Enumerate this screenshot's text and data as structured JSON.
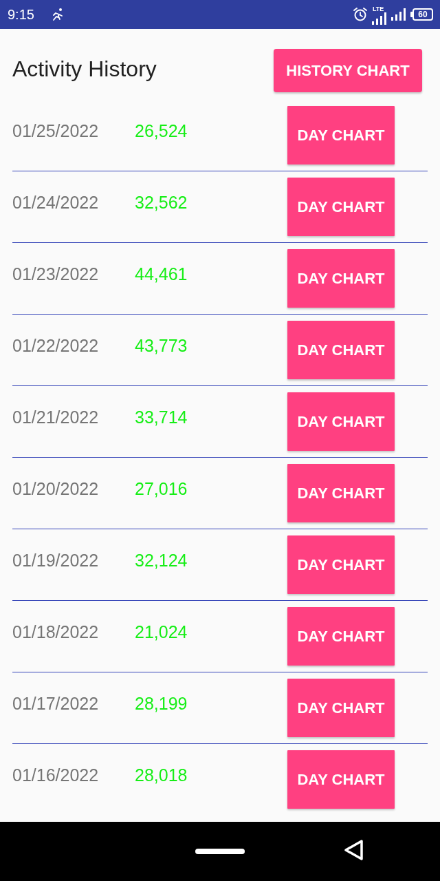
{
  "status_bar": {
    "time": "9:15",
    "network": "LTE",
    "battery": "60"
  },
  "header": {
    "title": "Activity History",
    "button": "HISTORY CHART"
  },
  "rows": [
    {
      "date": "01/25/2022",
      "steps": "26,524",
      "button": "DAY CHART"
    },
    {
      "date": "01/24/2022",
      "steps": "32,562",
      "button": "DAY CHART"
    },
    {
      "date": "01/23/2022",
      "steps": "44,461",
      "button": "DAY CHART"
    },
    {
      "date": "01/22/2022",
      "steps": "43,773",
      "button": "DAY CHART"
    },
    {
      "date": "01/21/2022",
      "steps": "33,714",
      "button": "DAY CHART"
    },
    {
      "date": "01/20/2022",
      "steps": "27,016",
      "button": "DAY CHART"
    },
    {
      "date": "01/19/2022",
      "steps": "32,124",
      "button": "DAY CHART"
    },
    {
      "date": "01/18/2022",
      "steps": "21,024",
      "button": "DAY CHART"
    },
    {
      "date": "01/17/2022",
      "steps": "28,199",
      "button": "DAY CHART"
    },
    {
      "date": "01/16/2022",
      "steps": "28,018",
      "button": "DAY CHART"
    }
  ]
}
